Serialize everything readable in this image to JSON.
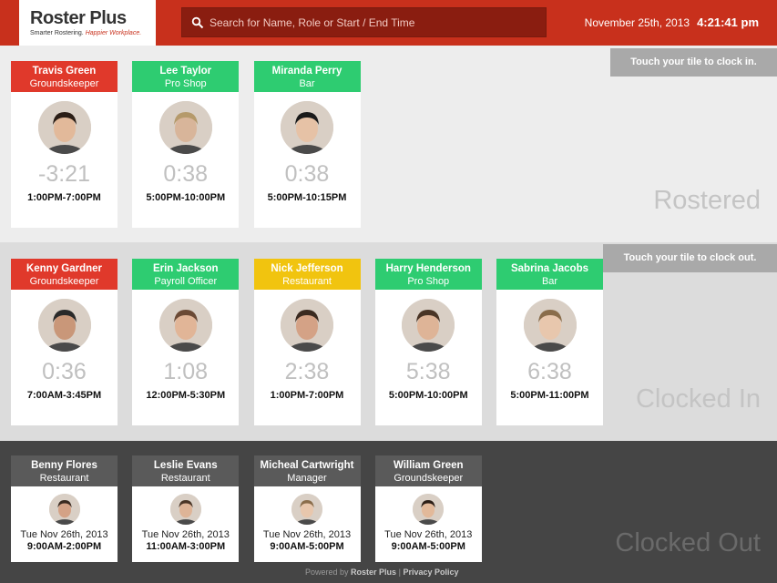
{
  "header": {
    "logo_title": "Roster Plus",
    "logo_tag_plain": "Smarter Rostering. ",
    "logo_tag_accent": "Happier Workplace.",
    "search_placeholder": "Search for Name, Role or Start / End Time",
    "date": "November 25th, 2013",
    "time": "4:21:41 pm"
  },
  "rostered": {
    "hint": "Touch your tile to clock in.",
    "label": "Rostered",
    "tiles": [
      {
        "name": "Travis Green",
        "role": "Groundskeeper",
        "timer": "-3:21",
        "shift": "1:00PM-7:00PM",
        "color": "#e0392b"
      },
      {
        "name": "Lee Taylor",
        "role": "Pro Shop",
        "timer": "0:38",
        "shift": "5:00PM-10:00PM",
        "color": "#2ecc71"
      },
      {
        "name": "Miranda Perry",
        "role": "Bar",
        "timer": "0:38",
        "shift": "5:00PM-10:15PM",
        "color": "#2ecc71"
      }
    ]
  },
  "clocked_in": {
    "hint": "Touch your tile to clock out.",
    "label": "Clocked In",
    "tiles": [
      {
        "name": "Kenny Gardner",
        "role": "Groundskeeper",
        "timer": "0:36",
        "shift": "7:00AM-3:45PM",
        "color": "#e0392b"
      },
      {
        "name": "Erin Jackson",
        "role": "Payroll Officer",
        "timer": "1:08",
        "shift": "12:00PM-5:30PM",
        "color": "#2ecc71"
      },
      {
        "name": "Nick Jefferson",
        "role": "Restaurant",
        "timer": "2:38",
        "shift": "1:00PM-7:00PM",
        "color": "#f1c40f"
      },
      {
        "name": "Harry Henderson",
        "role": "Pro Shop",
        "timer": "5:38",
        "shift": "5:00PM-10:00PM",
        "color": "#2ecc71"
      },
      {
        "name": "Sabrina Jacobs",
        "role": "Bar",
        "timer": "6:38",
        "shift": "5:00PM-11:00PM",
        "color": "#2ecc71"
      }
    ]
  },
  "clocked_out": {
    "label": "Clocked Out",
    "tiles": [
      {
        "name": "Benny Flores",
        "role": "Restaurant",
        "date": "Tue Nov 26th, 2013",
        "shift": "9:00AM-2:00PM"
      },
      {
        "name": "Leslie Evans",
        "role": "Restaurant",
        "date": "Tue Nov 26th, 2013",
        "shift": "11:00AM-3:00PM"
      },
      {
        "name": "Micheal Cartwright",
        "role": "Manager",
        "date": "Tue Nov 26th, 2013",
        "shift": "9:00AM-5:00PM"
      },
      {
        "name": "William Green",
        "role": "Groundskeeper",
        "date": "Tue Nov 26th, 2013",
        "shift": "9:00AM-5:00PM"
      }
    ]
  },
  "footer": {
    "powered_by": "Powered by",
    "brand": "Roster Plus",
    "separator": "|",
    "privacy": "Privacy Policy"
  }
}
